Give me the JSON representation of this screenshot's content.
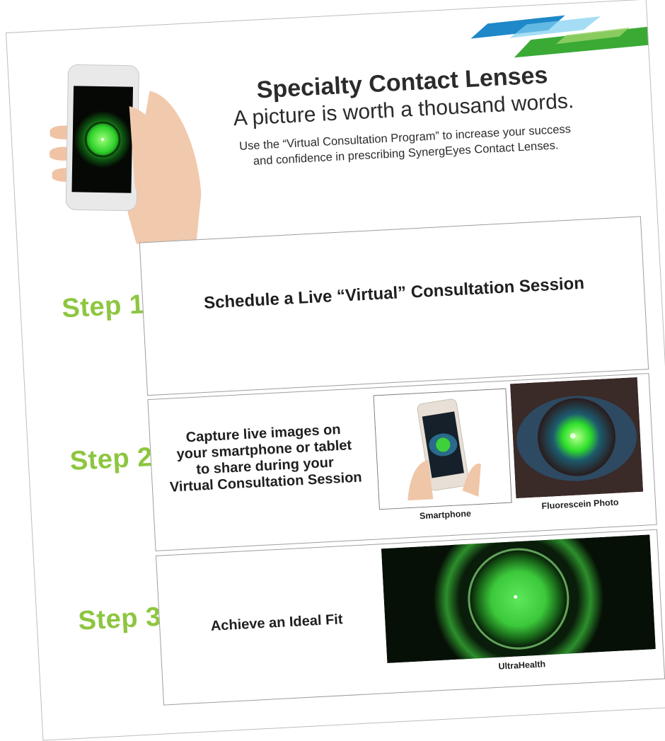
{
  "header": {
    "title": "Specialty Contact Lenses",
    "subtitle": "A picture is worth a thousand words.",
    "intro_line1": "Use the “Virtual Consultation Program” to increase your success",
    "intro_line2": "and confidence in prescribing SynergEyes Contact Lenses."
  },
  "brand": {
    "accent_green": "#8dc63f",
    "stripe_blue": "#1e88c8",
    "stripe_green": "#3aaa35"
  },
  "steps": [
    {
      "label": "Step 1",
      "text": "Schedule a Live “Virtual” Consultation Session"
    },
    {
      "label": "Step 2",
      "text_lines": [
        "Capture live images on",
        "your smartphone or tablet",
        "to share during your",
        "Virtual Consultation Session"
      ],
      "captions": [
        "Smartphone",
        "Fluorescein Photo"
      ]
    },
    {
      "label": "Step 3",
      "text": "Achieve an Ideal Fit",
      "caption": "UltraHealth"
    }
  ]
}
